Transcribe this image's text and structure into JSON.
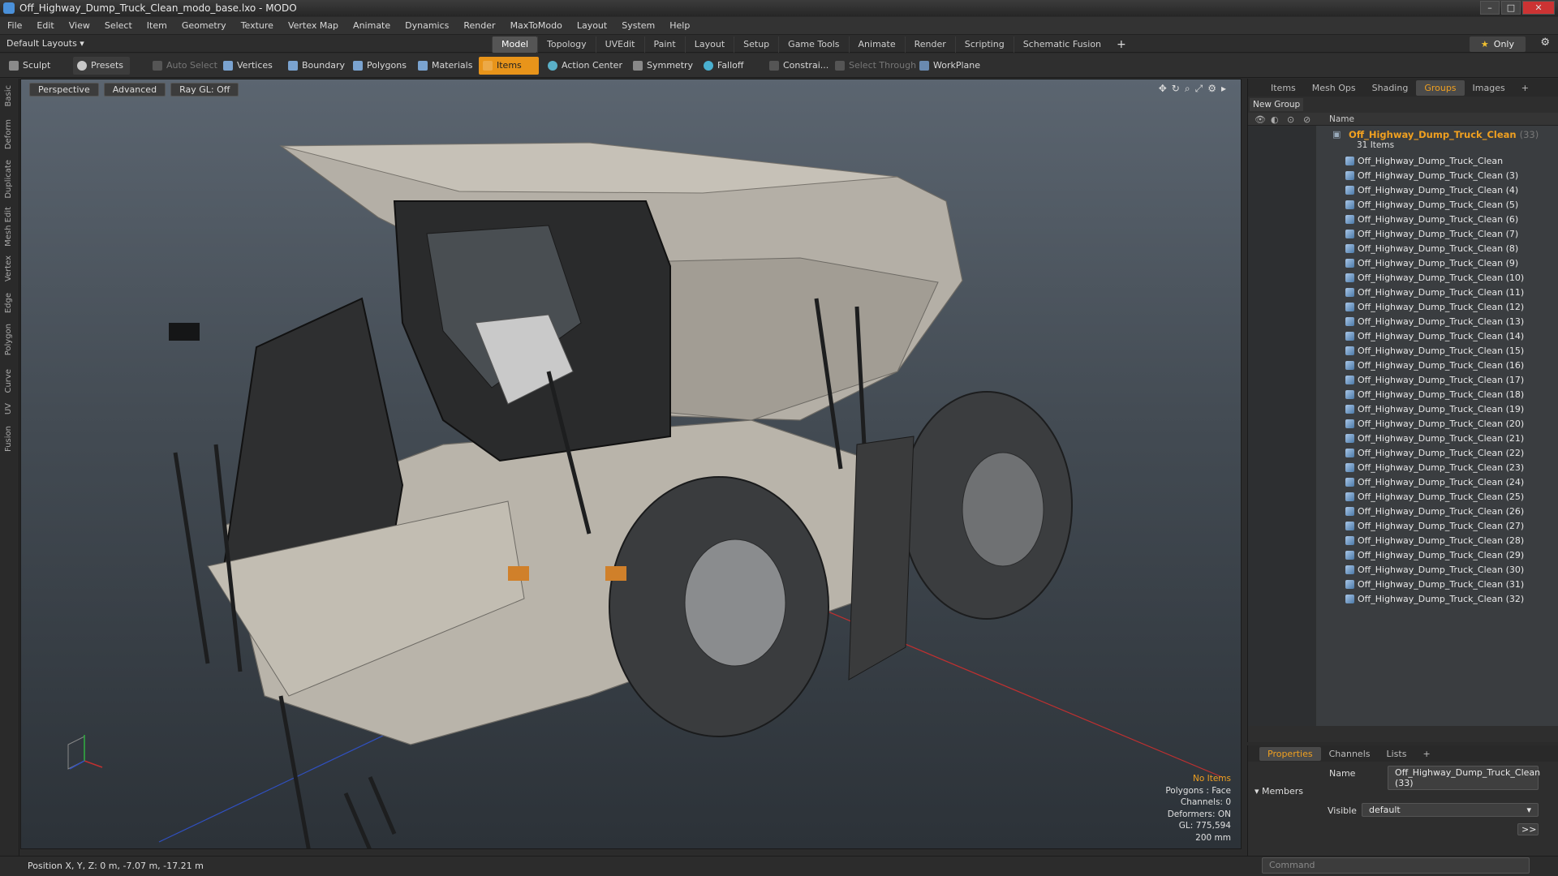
{
  "window": {
    "title": "Off_Highway_Dump_Truck_Clean_modo_base.lxo - MODO",
    "controls": [
      "–",
      "□",
      "✕"
    ]
  },
  "menu": [
    "File",
    "Edit",
    "View",
    "Select",
    "Item",
    "Geometry",
    "Texture",
    "Vertex Map",
    "Animate",
    "Dynamics",
    "Render",
    "MaxToModo",
    "Layout",
    "System",
    "Help"
  ],
  "layoutbar": {
    "layouts_label": "Default Layouts ▾",
    "tabs": [
      "Model",
      "Topology",
      "UVEdit",
      "Paint",
      "Layout",
      "Setup",
      "Game Tools",
      "Animate",
      "Render",
      "Scripting",
      "Schematic Fusion"
    ],
    "active_tab": "Model",
    "plus": "+",
    "only_label": "Only",
    "gear": "⚙"
  },
  "toolbar": {
    "sculpt": "Sculpt",
    "presets": "Presets",
    "auto_select": "Auto Select",
    "vertices": "Vertices",
    "boundary": "Boundary",
    "polygons": "Polygons",
    "materials": "Materials",
    "items": "Items",
    "action_center": "Action Center",
    "symmetry": "Symmetry",
    "falloff": "Falloff",
    "constraints": "Constrai...",
    "select_through": "Select Through",
    "workplane": "WorkPlane"
  },
  "left_strip": [
    "Basic",
    "Deform",
    "Duplicate",
    "Mesh Edit",
    "Vertex",
    "Edge",
    "Polygon",
    "Curve",
    "UV",
    "Fusion"
  ],
  "viewport": {
    "buttons": [
      "Perspective",
      "Advanced",
      "Ray GL: Off"
    ],
    "stats": [
      "No Items",
      "Polygons : Face",
      "Channels: 0",
      "Deformers: ON",
      "GL: 775,594",
      "200 mm"
    ]
  },
  "status": {
    "position": "Position X, Y, Z:  0 m, -7.07 m, -17.21 m"
  },
  "right_panel": {
    "tabs": [
      "Items",
      "Mesh Ops",
      "Shading",
      "Groups",
      "Images",
      "+"
    ],
    "active_tab": "Groups",
    "new_group": "New Group",
    "column_name": "Name",
    "group_name": "Off_Highway_Dump_Truck_Clean",
    "group_count_suffix": "(33)",
    "items_count": "31 Items",
    "items": [
      "Off_Highway_Dump_Truck_Clean",
      "Off_Highway_Dump_Truck_Clean (3)",
      "Off_Highway_Dump_Truck_Clean (4)",
      "Off_Highway_Dump_Truck_Clean (5)",
      "Off_Highway_Dump_Truck_Clean (6)",
      "Off_Highway_Dump_Truck_Clean (7)",
      "Off_Highway_Dump_Truck_Clean (8)",
      "Off_Highway_Dump_Truck_Clean (9)",
      "Off_Highway_Dump_Truck_Clean (10)",
      "Off_Highway_Dump_Truck_Clean (11)",
      "Off_Highway_Dump_Truck_Clean (12)",
      "Off_Highway_Dump_Truck_Clean (13)",
      "Off_Highway_Dump_Truck_Clean (14)",
      "Off_Highway_Dump_Truck_Clean (15)",
      "Off_Highway_Dump_Truck_Clean (16)",
      "Off_Highway_Dump_Truck_Clean (17)",
      "Off_Highway_Dump_Truck_Clean (18)",
      "Off_Highway_Dump_Truck_Clean (19)",
      "Off_Highway_Dump_Truck_Clean (20)",
      "Off_Highway_Dump_Truck_Clean (21)",
      "Off_Highway_Dump_Truck_Clean (22)",
      "Off_Highway_Dump_Truck_Clean (23)",
      "Off_Highway_Dump_Truck_Clean (24)",
      "Off_Highway_Dump_Truck_Clean (25)",
      "Off_Highway_Dump_Truck_Clean (26)",
      "Off_Highway_Dump_Truck_Clean (27)",
      "Off_Highway_Dump_Truck_Clean (28)",
      "Off_Highway_Dump_Truck_Clean (29)",
      "Off_Highway_Dump_Truck_Clean (30)",
      "Off_Highway_Dump_Truck_Clean (31)",
      "Off_Highway_Dump_Truck_Clean (32)"
    ]
  },
  "properties": {
    "tabs": [
      "Properties",
      "Channels",
      "Lists",
      "+"
    ],
    "active_tab": "Properties",
    "name_label": "Name",
    "name_value": "Off_Highway_Dump_Truck_Clean (33)",
    "members_label": "Members",
    "visible_label": "Visible",
    "visible_value": "default",
    "expand": ">>"
  },
  "command": {
    "placeholder": "Command"
  },
  "colors": {
    "accent": "#e8941a",
    "group_text": "#f0a020"
  }
}
